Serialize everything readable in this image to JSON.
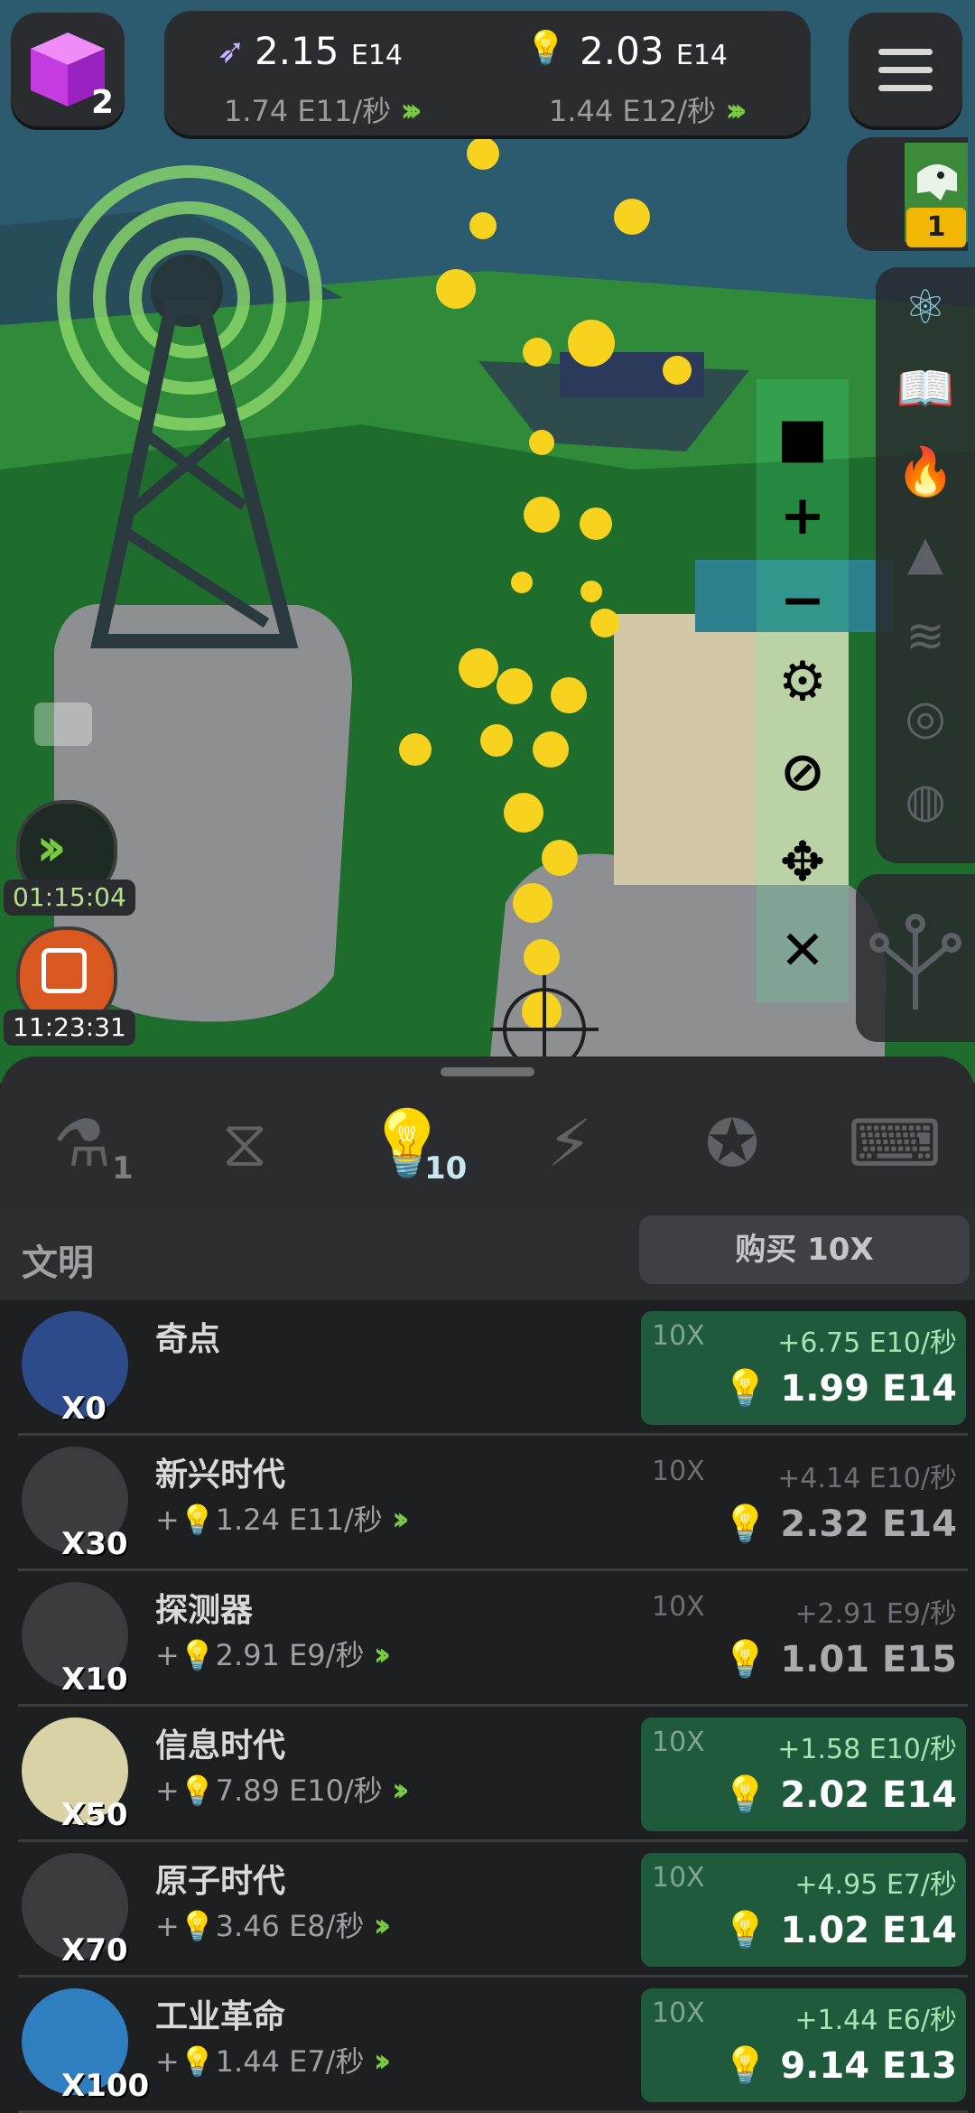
{
  "top": {
    "cube_count": "2",
    "resource1": {
      "value": "2.15",
      "exp": "E14",
      "rate": "1.74 E11/秒"
    },
    "resource2": {
      "value": "2.03",
      "exp": "E14",
      "rate": "1.44 E12/秒"
    },
    "dino_level": "1"
  },
  "left": {
    "boost_timer": "01:15:04",
    "event_timer": "11:23:31"
  },
  "tabs": [
    {
      "icon": "flask-icon",
      "count": "1"
    },
    {
      "icon": "dna-icon",
      "count": ""
    },
    {
      "icon": "lightbulb-icon",
      "count": "10"
    },
    {
      "icon": "lightning-icon",
      "count": ""
    },
    {
      "icon": "medal-icon",
      "count": ""
    },
    {
      "icon": "terminal-icon",
      "count": ""
    }
  ],
  "list": {
    "title": "文明",
    "buy_label": "购买 10X",
    "rows": [
      {
        "name": "奇点",
        "owned": "X0",
        "production": "",
        "mult": "10X",
        "gain": "+6.75 E10/秒",
        "price": "1.99 E14",
        "affordable": true
      },
      {
        "name": "新兴时代",
        "owned": "X30",
        "production": "1.24 E11/秒",
        "mult": "10X",
        "gain": "+4.14 E10/秒",
        "price": "2.32 E14",
        "affordable": false
      },
      {
        "name": "探测器",
        "owned": "X10",
        "production": "2.91 E9/秒",
        "mult": "10X",
        "gain": "+2.91 E9/秒",
        "price": "1.01 E15",
        "affordable": false
      },
      {
        "name": "信息时代",
        "owned": "X50",
        "production": "7.89 E10/秒",
        "mult": "10X",
        "gain": "+1.58 E10/秒",
        "price": "2.02 E14",
        "affordable": true
      },
      {
        "name": "原子时代",
        "owned": "X70",
        "production": "3.46 E8/秒",
        "mult": "10X",
        "gain": "+4.95 E7/秒",
        "price": "1.02 E14",
        "affordable": true
      },
      {
        "name": "工业革命",
        "owned": "X100",
        "production": "1.44 E7/秒",
        "mult": "10X",
        "gain": "+1.44 E6/秒",
        "price": "9.14 E13",
        "affordable": true
      }
    ]
  },
  "colors": {
    "accent": "#7ac943",
    "active_tab": "#8ecbe0",
    "affordable_bg": "#1f5a3d",
    "bulb": "#f5c518"
  }
}
